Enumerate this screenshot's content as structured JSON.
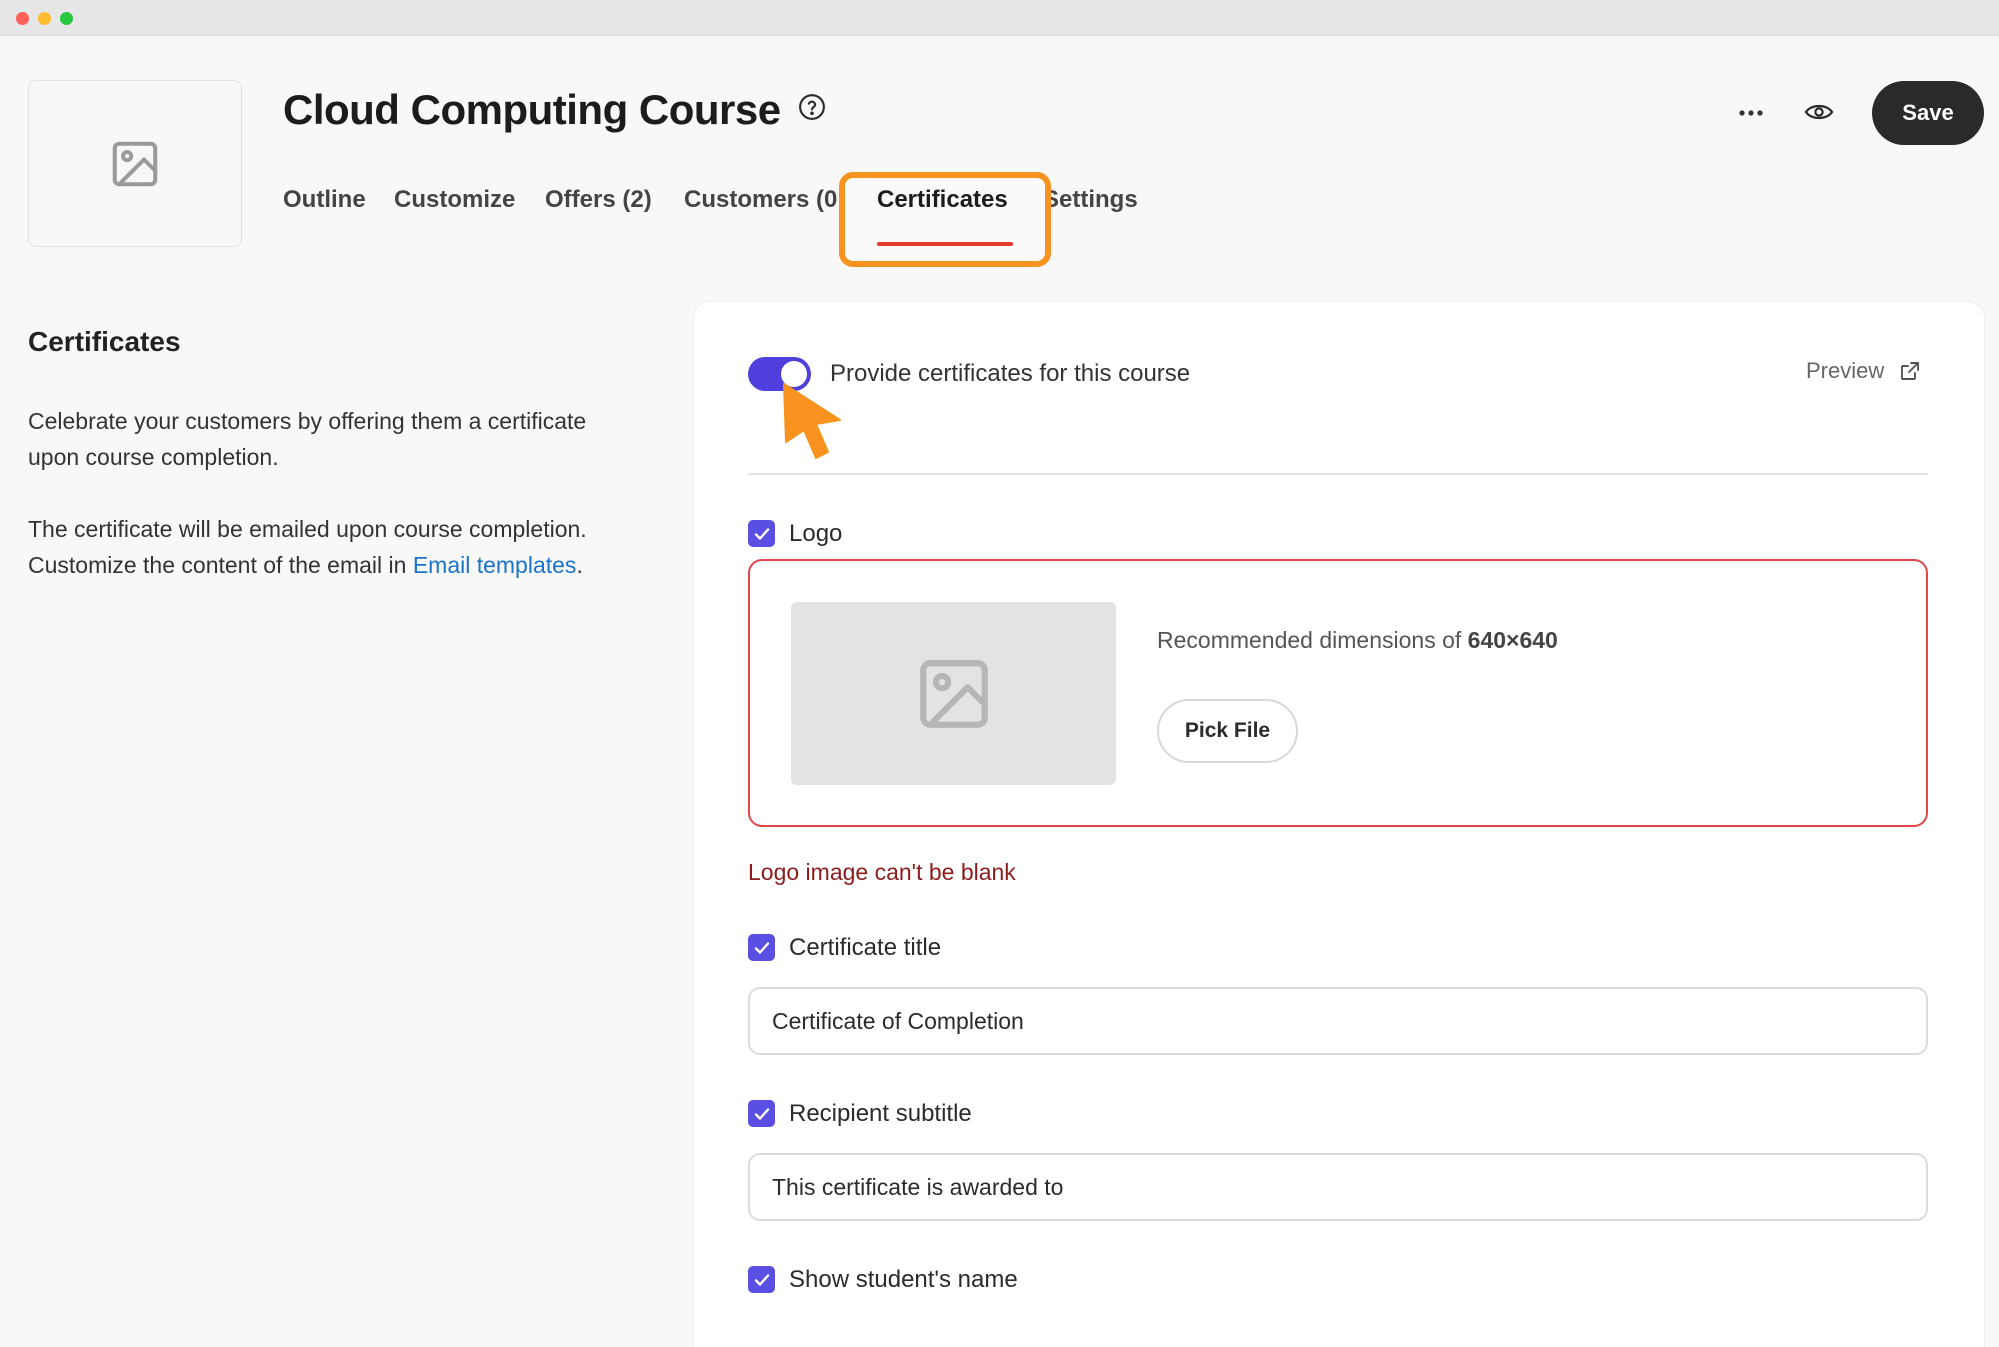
{
  "course": {
    "title": "Cloud Computing Course"
  },
  "tabs": [
    {
      "label": "Outline"
    },
    {
      "label": "Customize"
    },
    {
      "label": "Offers (2)"
    },
    {
      "label": "Customers (0"
    },
    {
      "label": "Certificates",
      "active": true
    },
    {
      "label": "Settings"
    }
  ],
  "header": {
    "save_label": "Save"
  },
  "sidebar": {
    "heading": "Certificates",
    "paragraph1": "Celebrate your customers by offering them a certificate upon course completion.",
    "paragraph2_prefix": "The certificate will be emailed upon course completion. Customize the content of the email in ",
    "paragraph2_link": "Email templates",
    "paragraph2_suffix": "."
  },
  "certificate_settings": {
    "toggle_label": "Provide certificates for this course",
    "toggle_on": true,
    "preview_label": "Preview",
    "logo": {
      "label": "Logo",
      "checked": true,
      "recommended_prefix": "Recommended dimensions of ",
      "recommended_value": "640×640",
      "pick_file_label": "Pick File",
      "error": "Logo image can't be blank"
    },
    "certificate_title": {
      "label": "Certificate title",
      "checked": true,
      "value": "Certificate of Completion"
    },
    "recipient_subtitle": {
      "label": "Recipient subtitle",
      "checked": true,
      "value": "This certificate is awarded to"
    },
    "show_student_name": {
      "label": "Show student's name",
      "checked": true
    }
  },
  "colors": {
    "accent": "#4f3fdc",
    "checkbox": "#5b4fe3",
    "error": "#e0464a",
    "highlight": "#f7931e",
    "tab_underline": "#e53b2c",
    "link": "#1a73c9"
  },
  "icons": {
    "help": "question-circle-icon",
    "more": "ellipsis-icon",
    "preview": "eye-icon",
    "external": "external-link-icon",
    "image": "image-placeholder-icon",
    "check": "checkmark-icon",
    "cursor": "cursor-arrow-icon"
  }
}
